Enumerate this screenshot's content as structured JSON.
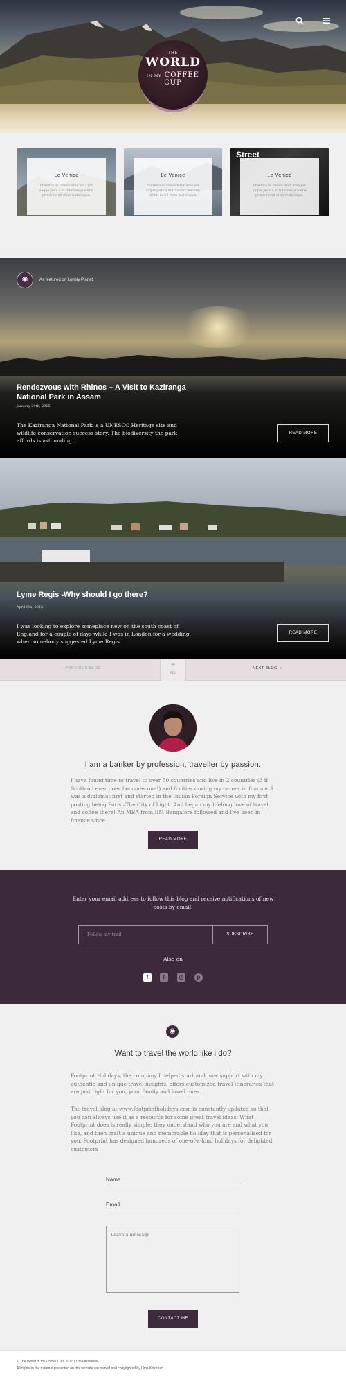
{
  "hero": {
    "logo_top": "THE",
    "logo_title": "WORLD",
    "logo_mid": "IN MY",
    "logo_bottom": "COFFEE CUP",
    "search_icon": "search-icon",
    "menu_icon": "hamburger-menu-icon"
  },
  "cards": [
    {
      "title": "Le Venice",
      "desc": "Pharetra ac consectetur urna per augue justo a et ridiculus placerat primis iaculi diam scelerisque."
    },
    {
      "title": "Le Venice",
      "desc": "Pharetra ac consectetur urna per augue justo a et ridiculus placerat primis iaculi diam scelerisque."
    },
    {
      "title": "Le Venice",
      "desc": "Pharetra ac consectetur urna per augue justo a et ridiculus placerat primis iaculi diam scelerisque.",
      "overlay_text": "Street"
    }
  ],
  "posts": [
    {
      "badge": "As featured on Lonely Planet",
      "title": "Rendezvous with Rhinos – A Visit to Kaziranga National Park in Assam",
      "date": "January 29th, 2015",
      "excerpt": "The Kaziranga National Park is a UNESCO Heritage site and wildlife conservation success story. The biodiversity the park affords is astounding...",
      "read_more": "READ MORE"
    },
    {
      "title": "Lyme Regis -Why should I go there?",
      "date": "April 6th, 2015",
      "excerpt": "I was looking to explore someplace new on the south coast of England for a couple of days while I was in London for a wedding, when somebody suggested Lyme Regis...",
      "read_more": "READ MORE"
    }
  ],
  "pager": {
    "prev": "PREVIOUS BLOG",
    "all": "ALL",
    "next": "NEXT BLOG"
  },
  "about": {
    "heading": "I am a banker by profession, traveller by passion.",
    "text": "I have found time to travel to over 50 countries and live in 2 countries (3 if Scotland ever does becomes one!) and 6 cities during my career in finance. I was a diplomat first and started in the Indian Foreign Service with my first posting being Paris –The City of Light. And began my lifelong love of travel and coffee there! An MBA from IIM Bangalore followed and I've been in finance since.",
    "button": "READ MORE"
  },
  "subscribe": {
    "intro": "Enter your email address to follow this blog and receive notifications of new posts by email.",
    "placeholder": "Follow my trail",
    "button": "SUBSCRIBE",
    "also_on": "Also on",
    "social": [
      "facebook-icon",
      "twitter-icon",
      "instagram-icon",
      "pinterest-icon"
    ]
  },
  "travel": {
    "heading": "Want to travel the world like i do?",
    "para1": "Footprint Holidays, the company I helped start and now support with my authentic and unique travel insights, offers customized travel itineraries that are just right for you, your family and loved ones.",
    "para2": "The travel blog at www.footprintholidays.com is constantly updated so that you can always use it as a resource for some great travel ideas. What Footprint does is really simple: they understand who you are and what you like, and then craft a unique and memorable holiday that is personalised for you. Footprint has designed hundreds of one-of-a-kind holidays for delighted customers",
    "name_label": "Name",
    "email_label": "Email",
    "message_placeholder": "Leave a message",
    "button": "CONTACT ME"
  },
  "footer": {
    "line1": "© The World in my Coffee Cup, 2015 | Uma Krishnan.",
    "line2": "All rights to the material presented on this website are owned and copyrighted by Uma Krishnan."
  },
  "colors": {
    "brand": "#3e2a3c",
    "pager_bg": "#e5dde0"
  }
}
